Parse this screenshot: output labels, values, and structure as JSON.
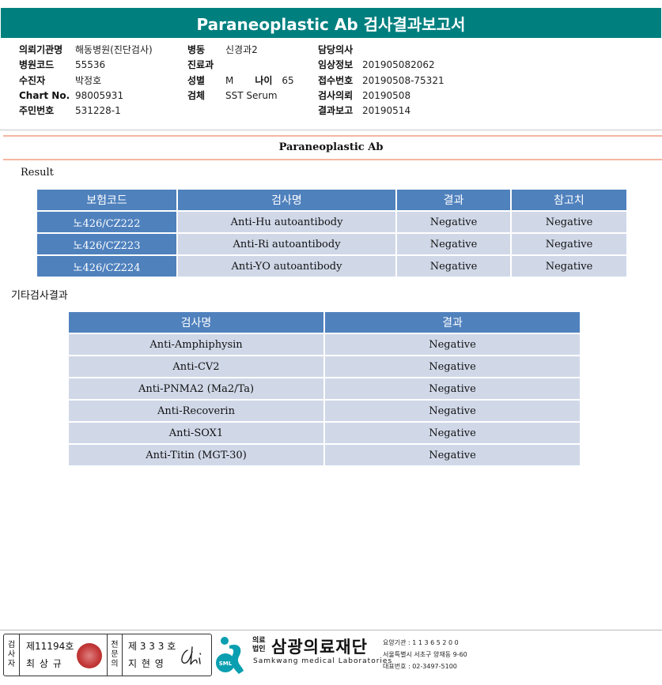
{
  "title": "Paraneoplastic Ab 검사결과보고서",
  "info": {
    "col1": [
      {
        "label": "의뢰기관명",
        "value": "해동병원(진단검사)"
      },
      {
        "label": "병원코드",
        "value": "55536"
      },
      {
        "label": "수진자",
        "value": "박정호"
      },
      {
        "label": "Chart No.",
        "value": "98005931"
      },
      {
        "label": "주민번호",
        "value": "531228-1"
      }
    ],
    "col2": [
      {
        "label": "병동",
        "value": "신경과2"
      },
      {
        "label": "진료과",
        "value": ""
      },
      {
        "label": "성별",
        "value": "M"
      },
      {
        "label": "검체",
        "value": "SST Serum"
      }
    ],
    "age": {
      "label": "나이",
      "value": "65"
    },
    "col3": [
      {
        "label": "담당의사",
        "value": ""
      },
      {
        "label": "임상정보",
        "value": "201905082062"
      },
      {
        "label": "접수번호",
        "value": "20190508-75321"
      },
      {
        "label": "검사의뢰",
        "value": "20190508"
      },
      {
        "label": "결과보고",
        "value": "20190514"
      }
    ]
  },
  "section_title": "Paraneoplastic Ab",
  "result_label": "Result",
  "result_table": {
    "headers": [
      "보험코드",
      "검사명",
      "결과",
      "참고치"
    ],
    "rows": [
      [
        "노426/CZ222",
        "Anti-Hu autoantibody",
        "Negative",
        "Negative"
      ],
      [
        "노426/CZ223",
        "Anti-Ri autoantibody",
        "Negative",
        "Negative"
      ],
      [
        "노426/CZ224",
        "Anti-YO autoantibody",
        "Negative",
        "Negative"
      ]
    ]
  },
  "other_label": "기타검사결과",
  "other_table": {
    "headers": [
      "검사명",
      "결과"
    ],
    "rows": [
      [
        "Anti-Amphiphysin",
        "Negative"
      ],
      [
        "Anti-CV2",
        "Negative"
      ],
      [
        "Anti-PNMA2 (Ma2/Ta)",
        "Negative"
      ],
      [
        "Anti-Recoverin",
        "Negative"
      ],
      [
        "Anti-SOX1",
        "Negative"
      ],
      [
        "Anti-Titin (MGT-30)",
        "Negative"
      ]
    ]
  },
  "footer": {
    "tester_label": [
      "검",
      "사",
      "자"
    ],
    "tester_no": "제11194호",
    "tester_name": "최 상 규",
    "specialist_label": [
      "전",
      "문",
      "의"
    ],
    "specialist_no": "제 3 3 3 호",
    "specialist_name": "지 현 영",
    "org_small": [
      "의료",
      "법인"
    ],
    "org_name": "삼광의료재단",
    "org_en": "Samkwang medical Laboratories",
    "org_code": "요양기관 : 1 1 3 6 5 2 0 0",
    "org_address": "서울특별시 서초구 양재동 9-60",
    "org_phone": "대표번호 : 02-3497-5100",
    "logo_text": "SML"
  },
  "colors": {
    "title_bar": "#007f7f",
    "header_cell": "#4f81bd",
    "body_cell": "#d0d8e8",
    "separator": "#f4b6a0",
    "logo": "#0a9fb0"
  }
}
